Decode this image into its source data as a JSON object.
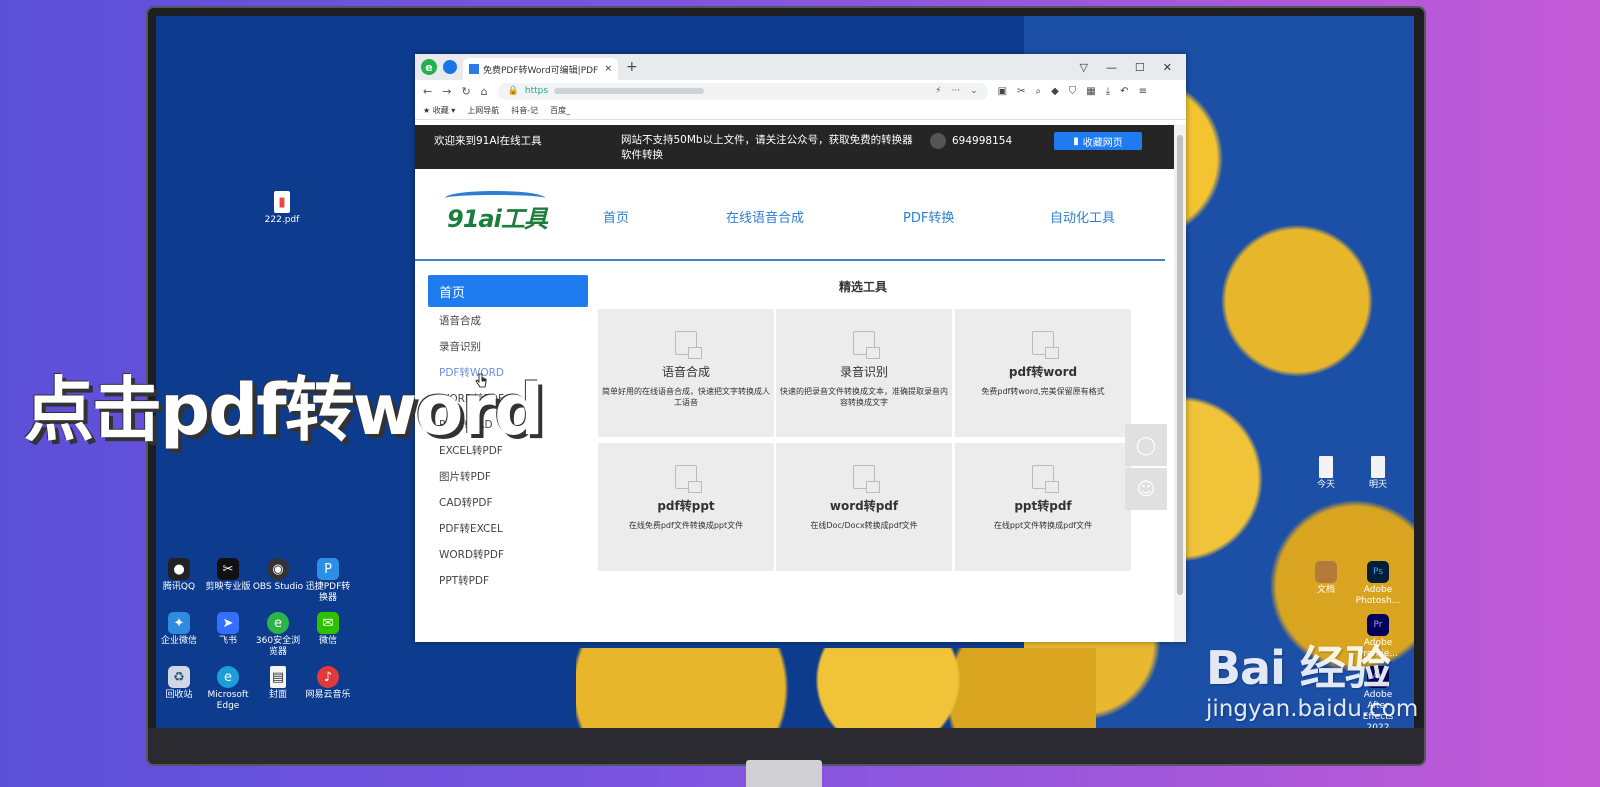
{
  "desktop": {
    "pdf_file": "222.pdf",
    "left_icons": [
      "腾讯QQ",
      "剪映专业版",
      "OBS Studio",
      "迅捷PDF转换器",
      "企业微信",
      "飞书",
      "360安全浏览器",
      "微信",
      "回收站",
      "Microsoft Edge",
      "封面",
      "网易云音乐"
    ],
    "right_icons": [
      "今天",
      "明天",
      "文档",
      "Adobe Photosh...",
      "Adobe Premie...",
      "Adobe After Effects 2022"
    ]
  },
  "browser": {
    "tab_title": "免费PDF转Word可编辑|PDF",
    "url_prefix": "https",
    "bookmarks": [
      "收藏",
      "上网导航",
      "抖音-记",
      "百度_"
    ]
  },
  "topbar": {
    "welcome": "欢迎来到91AI在线工具",
    "notice": "网站不支持50Mb以上文件，请关注公众号，获取免费的转换器软件转换",
    "qq": "694998154",
    "bookmark_button": "收藏网页"
  },
  "header": {
    "logo": "91ai工具",
    "nav": [
      "首页",
      "在线语音合成",
      "PDF转换",
      "自动化工具"
    ]
  },
  "sidebar": {
    "active": "首页",
    "items": [
      "语音合成",
      "录音识别",
      "PDF转WORD",
      "WORD转PDF",
      "PDF转CAD",
      "EXCEL转PDF",
      "图片转PDF",
      "CAD转PDF",
      "PDF转EXCEL",
      "WORD转PDF",
      "PPT转PDF"
    ]
  },
  "section_title": "精选工具",
  "cards": [
    {
      "title": "语音合成",
      "desc": "简单好用的在线语音合成，快速把文字转换成人工语音"
    },
    {
      "title": "录音识别",
      "desc": "快速的把录音文件转换成文本，准确提取录音内容转换成文字"
    },
    {
      "title": "pdf转word",
      "desc": "免费pdf转word,完美保留原有格式"
    },
    {
      "title": "pdf转ppt",
      "desc": "在线免费pdf文件转换成ppt文件"
    },
    {
      "title": "word转pdf",
      "desc": "在线Doc/Docx转换成pdf文件"
    },
    {
      "title": "ppt转pdf",
      "desc": "在线ppt文件转换成pdf文件"
    }
  ],
  "caption": "点击pdf转word",
  "watermark": {
    "brand": "Bai 经验",
    "url": "jingyan.baidu.com"
  }
}
